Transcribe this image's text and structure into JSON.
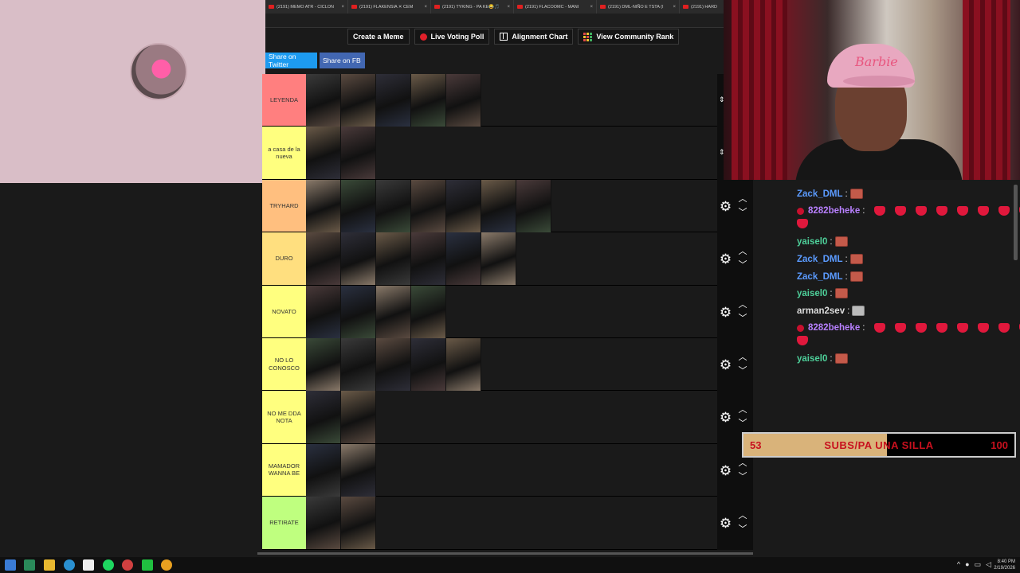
{
  "browser_tabs": [
    {
      "title": "(2191) MEMO ATR - CICLON"
    },
    {
      "title": "(2191) FLAKENSIA ✕ CEM"
    },
    {
      "title": "(2191) TYKING - PA KE😂🎵"
    },
    {
      "title": "(2191) FLACOOMC - MANI"
    },
    {
      "title": "(2191) DML-NIÑO E TSTA (I"
    },
    {
      "title": "(2191) HARD"
    }
  ],
  "toolbar_buttons": {
    "create_meme": "Create a Meme",
    "live_voting": "Live Voting Poll",
    "alignment_chart": "Alignment Chart",
    "community_rank": "View Community Rank"
  },
  "share": {
    "twitter": "Share on Twitter",
    "facebook": "Share on FB"
  },
  "tiers": [
    {
      "label": "LEYENDA",
      "color": "#ff7f7f",
      "thumb_count": 5
    },
    {
      "label": "a casa de la nueva",
      "color": "#ffff7f",
      "thumb_count": 2
    },
    {
      "label": "TRYHARD",
      "color": "#ffbf7f",
      "thumb_count": 7
    },
    {
      "label": "DURO",
      "color": "#ffdf7f",
      "thumb_count": 6
    },
    {
      "label": "NOVATO",
      "color": "#ffff7f",
      "thumb_count": 4
    },
    {
      "label": "NO LO CONOSCO",
      "color": "#ffff7f",
      "thumb_count": 5
    },
    {
      "label": "NO ME DDA NOTA",
      "color": "#ffff7f",
      "thumb_count": 2
    },
    {
      "label": "MAMADOR WANNA BE",
      "color": "#ffff7f",
      "thumb_count": 2
    },
    {
      "label": "RETIRATE",
      "color": "#bfff7f",
      "thumb_count": 2
    }
  ],
  "webcam": {
    "cap_text": "Barbie"
  },
  "chat": {
    "messages": [
      {
        "user": "Zack_DML",
        "color": "#5b9bff",
        "badge": false,
        "emotes": 1,
        "hearts": 0
      },
      {
        "user": "8282beheke",
        "color": "#b880ff",
        "badge": true,
        "emotes": 0,
        "hearts": 9
      },
      {
        "user": "yaisel0",
        "color": "#4ed09a",
        "badge": false,
        "emotes": 1,
        "hearts": 0
      },
      {
        "user": "Zack_DML",
        "color": "#5b9bff",
        "badge": false,
        "emotes": 1,
        "hearts": 0
      },
      {
        "user": "Zack_DML",
        "color": "#5b9bff",
        "badge": false,
        "emotes": 1,
        "hearts": 0
      },
      {
        "user": "yaisel0",
        "color": "#4ed09a",
        "badge": false,
        "emotes": 1,
        "hearts": 0
      },
      {
        "user": "arman2sev",
        "color": "#dddddd",
        "badge": false,
        "emotes": 1,
        "hearts": 0,
        "gray_emote": true
      },
      {
        "user": "8282beheke",
        "color": "#b880ff",
        "badge": true,
        "emotes": 0,
        "hearts": 9
      },
      {
        "user": "yaisel0",
        "color": "#4ed09a",
        "badge": false,
        "emotes": 1,
        "hearts": 0
      }
    ]
  },
  "goal": {
    "current": "53",
    "title": "SUBS/PA UNA SILLA",
    "max": "100",
    "progress": 0.53
  },
  "taskbar": {
    "time": "8:40 PM",
    "date": "2/19/2026"
  }
}
